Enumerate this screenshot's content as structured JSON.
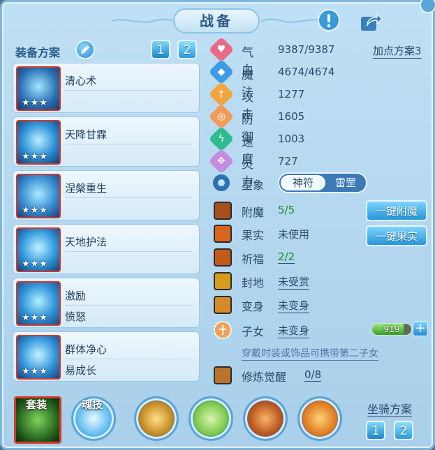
{
  "title": "战备",
  "scheme": {
    "label": "装备方案",
    "buttons": [
      "1",
      "2"
    ]
  },
  "skills": [
    {
      "name": "清心术",
      "name2": "",
      "stars": "★★★"
    },
    {
      "name": "天降甘霖",
      "name2": "",
      "stars": "★★★"
    },
    {
      "name": "涅槃重生",
      "name2": "",
      "stars": "★★★"
    },
    {
      "name": "天地护法",
      "name2": "",
      "stars": "★★★"
    },
    {
      "name": "激励",
      "name2": "愤怒",
      "stars": "★★★"
    },
    {
      "name": "群体净心",
      "name2": "易成长",
      "stars": "★★★"
    }
  ],
  "plus_scheme": "加点方案3",
  "stats": [
    {
      "name": "气血",
      "value": "9387/9387",
      "color": "#e86a86",
      "glyph": "♥"
    },
    {
      "name": "魔法",
      "value": "4674/4674",
      "color": "#3f9be6",
      "glyph": "◆"
    },
    {
      "name": "攻击",
      "value": "1277",
      "color": "#f0a63c",
      "glyph": "†"
    },
    {
      "name": "防御",
      "value": "1605",
      "color": "#f29a58",
      "glyph": "◎"
    },
    {
      "name": "速度",
      "value": "1003",
      "color": "#2ebc8e",
      "glyph": "ϟ"
    },
    {
      "name": "灵力",
      "value": "727",
      "color": "#c58be0",
      "glyph": "✥"
    }
  ],
  "xingxiang": {
    "label": "星象",
    "on": "神符",
    "off": "雷罡"
  },
  "equip": [
    {
      "name": "附魔",
      "value": "5/5",
      "color": "#1e8a2a",
      "underline": false
    },
    {
      "name": "果实",
      "value": "未使用",
      "color": "#2a4b6b",
      "underline": false
    },
    {
      "name": "祈福",
      "value": "2/2",
      "color": "#1e8a2a",
      "underline": true
    },
    {
      "name": "封地",
      "value": "未受赏",
      "color": "#2a4b6b",
      "underline": true
    },
    {
      "name": "变身",
      "value": "未变身",
      "color": "#2a4b6b",
      "underline": true
    },
    {
      "name": "子女",
      "value": "未变身",
      "color": "#2a4b6b",
      "underline": true
    }
  ],
  "actions": {
    "enchant": "一键附魔",
    "fruit": "一键果实"
  },
  "child_bar": {
    "value": "919",
    "fill_fraction": 0.8
  },
  "hint": "穿戴时装或饰品可携带第二子女",
  "cultivation": {
    "name": "修炼觉醒",
    "value": "0/8"
  },
  "bottom": {
    "suit": "套装",
    "soul": "魂技"
  },
  "mount": {
    "label": "坐骑方案",
    "buttons": [
      "1",
      "2"
    ]
  }
}
